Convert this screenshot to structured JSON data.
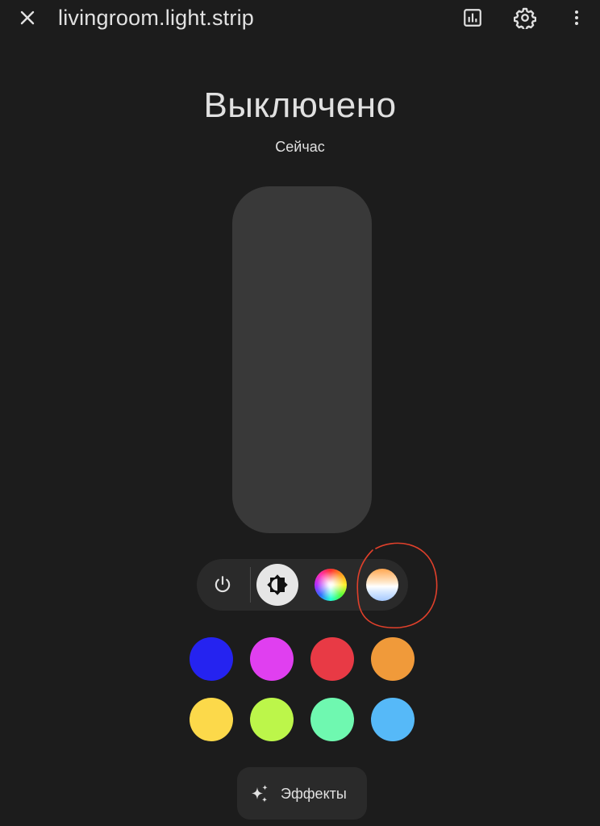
{
  "dialog": {
    "title": "livingroom.light.strip",
    "state": "Выключено",
    "last_changed": "Сейчас"
  },
  "header": {
    "close_icon": "close-icon",
    "history_icon": "chart-bar-icon",
    "settings_icon": "gear-icon",
    "more_icon": "more-vertical-icon"
  },
  "brightness": {
    "value_percent": 0
  },
  "modes": [
    {
      "name": "power",
      "icon": "power-icon",
      "active": false
    },
    {
      "name": "brightness",
      "icon": "brightness-icon",
      "active": true
    },
    {
      "name": "color",
      "icon": "color-wheel-icon",
      "active": false
    },
    {
      "name": "color_temp",
      "icon": "color-temperature-icon",
      "active": false
    }
  ],
  "favorite_colors": [
    {
      "color": "#2523f0"
    },
    {
      "color": "#e03ff0"
    },
    {
      "color": "#e83a45"
    },
    {
      "color": "#f09a3a"
    },
    {
      "color": "#fcd94a"
    },
    {
      "color": "#bcf64a"
    },
    {
      "color": "#6ff8b0"
    },
    {
      "color": "#56b9f8"
    }
  ],
  "effects": {
    "label": "Эффекты",
    "icon": "sparkles-icon"
  },
  "colors": {
    "background": "#1c1c1c",
    "slider_track": "#393939",
    "annotation": "#e0402b"
  }
}
